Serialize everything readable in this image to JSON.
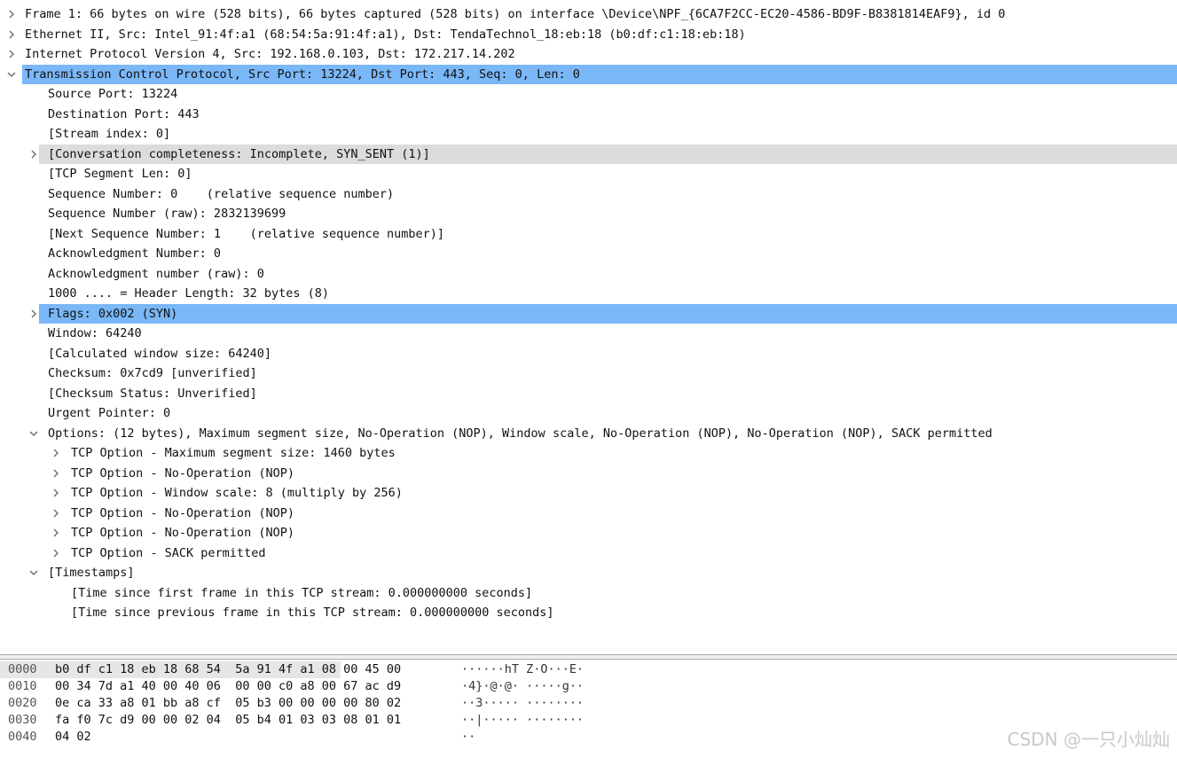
{
  "tree": [
    {
      "indent": 0,
      "toggle": "collapsed",
      "state": "",
      "text": "Frame 1: 66 bytes on wire (528 bits), 66 bytes captured (528 bits) on interface \\Device\\NPF_{6CA7F2CC-EC20-4586-BD9F-B8381814EAF9}, id 0"
    },
    {
      "indent": 0,
      "toggle": "collapsed",
      "state": "",
      "text": "Ethernet II, Src: Intel_91:4f:a1 (68:54:5a:91:4f:a1), Dst: TendaTechnol_18:eb:18 (b0:df:c1:18:eb:18)"
    },
    {
      "indent": 0,
      "toggle": "collapsed",
      "state": "",
      "text": "Internet Protocol Version 4, Src: 192.168.0.103, Dst: 172.217.14.202"
    },
    {
      "indent": 0,
      "toggle": "expanded",
      "state": "selected",
      "text": "Transmission Control Protocol, Src Port: 13224, Dst Port: 443, Seq: 0, Len: 0"
    },
    {
      "indent": 1,
      "toggle": "none",
      "state": "",
      "text": "Source Port: 13224"
    },
    {
      "indent": 1,
      "toggle": "none",
      "state": "",
      "text": "Destination Port: 443"
    },
    {
      "indent": 1,
      "toggle": "none",
      "state": "",
      "text": "[Stream index: 0]"
    },
    {
      "indent": 1,
      "toggle": "collapsed",
      "state": "hover",
      "text": "[Conversation completeness: Incomplete, SYN_SENT (1)]"
    },
    {
      "indent": 1,
      "toggle": "none",
      "state": "",
      "text": "[TCP Segment Len: 0]"
    },
    {
      "indent": 1,
      "toggle": "none",
      "state": "",
      "text": "Sequence Number: 0    (relative sequence number)"
    },
    {
      "indent": 1,
      "toggle": "none",
      "state": "",
      "text": "Sequence Number (raw): 2832139699"
    },
    {
      "indent": 1,
      "toggle": "none",
      "state": "",
      "text": "[Next Sequence Number: 1    (relative sequence number)]"
    },
    {
      "indent": 1,
      "toggle": "none",
      "state": "",
      "text": "Acknowledgment Number: 0"
    },
    {
      "indent": 1,
      "toggle": "none",
      "state": "",
      "text": "Acknowledgment number (raw): 0"
    },
    {
      "indent": 1,
      "toggle": "none",
      "state": "",
      "text": "1000 .... = Header Length: 32 bytes (8)"
    },
    {
      "indent": 1,
      "toggle": "collapsed",
      "state": "selected",
      "text": "Flags: 0x002 (SYN)"
    },
    {
      "indent": 1,
      "toggle": "none",
      "state": "",
      "text": "Window: 64240"
    },
    {
      "indent": 1,
      "toggle": "none",
      "state": "",
      "text": "[Calculated window size: 64240]"
    },
    {
      "indent": 1,
      "toggle": "none",
      "state": "",
      "text": "Checksum: 0x7cd9 [unverified]"
    },
    {
      "indent": 1,
      "toggle": "none",
      "state": "",
      "text": "[Checksum Status: Unverified]"
    },
    {
      "indent": 1,
      "toggle": "none",
      "state": "",
      "text": "Urgent Pointer: 0"
    },
    {
      "indent": 1,
      "toggle": "expanded",
      "state": "",
      "text": "Options: (12 bytes), Maximum segment size, No-Operation (NOP), Window scale, No-Operation (NOP), No-Operation (NOP), SACK permitted"
    },
    {
      "indent": 2,
      "toggle": "collapsed",
      "state": "",
      "text": "TCP Option - Maximum segment size: 1460 bytes"
    },
    {
      "indent": 2,
      "toggle": "collapsed",
      "state": "",
      "text": "TCP Option - No-Operation (NOP)"
    },
    {
      "indent": 2,
      "toggle": "collapsed",
      "state": "",
      "text": "TCP Option - Window scale: 8 (multiply by 256)"
    },
    {
      "indent": 2,
      "toggle": "collapsed",
      "state": "",
      "text": "TCP Option - No-Operation (NOP)"
    },
    {
      "indent": 2,
      "toggle": "collapsed",
      "state": "",
      "text": "TCP Option - No-Operation (NOP)"
    },
    {
      "indent": 2,
      "toggle": "collapsed",
      "state": "",
      "text": "TCP Option - SACK permitted"
    },
    {
      "indent": 1,
      "toggle": "expanded",
      "state": "",
      "text": "[Timestamps]"
    },
    {
      "indent": 2,
      "toggle": "none",
      "state": "",
      "text": "[Time since first frame in this TCP stream: 0.000000000 seconds]"
    },
    {
      "indent": 2,
      "toggle": "none",
      "state": "",
      "text": "[Time since previous frame in this TCP stream: 0.000000000 seconds]"
    }
  ],
  "hex": [
    {
      "offset": "0000",
      "bytes": "b0 df c1 18 eb 18 68 54  5a 91 4f a1 08 00 45 00",
      "ascii": "······hT Z·O···E·"
    },
    {
      "offset": "0010",
      "bytes": "00 34 7d a1 40 00 40 06  00 00 c0 a8 00 67 ac d9",
      "ascii": "·4}·@·@· ·····g··"
    },
    {
      "offset": "0020",
      "bytes": "0e ca 33 a8 01 bb a8 cf  05 b3 00 00 00 00 80 02",
      "ascii": "··3····· ········"
    },
    {
      "offset": "0030",
      "bytes": "fa f0 7c d9 00 00 02 04  05 b4 01 03 03 08 01 01",
      "ascii": "··|····· ········"
    },
    {
      "offset": "0040",
      "bytes": "04 02",
      "ascii": "··"
    }
  ],
  "colors": {
    "selected": "#7ab7f7",
    "hover": "#dcdcdc"
  },
  "icons": {
    "collapsed": "chevron-right-icon",
    "expanded": "chevron-down-icon"
  },
  "watermark": "CSDN @一只小灿灿"
}
